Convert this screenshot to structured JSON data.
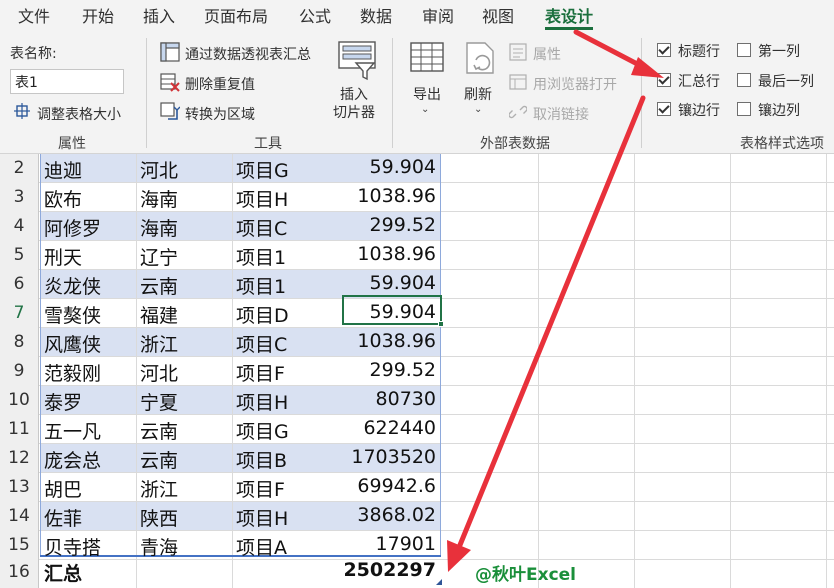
{
  "tabs": [
    "文件",
    "开始",
    "插入",
    "页面布局",
    "公式",
    "数据",
    "审阅",
    "视图",
    "表设计"
  ],
  "active_tab": "表设计",
  "ribbon": {
    "properties": {
      "name_label": "表名称:",
      "name_value": "表1",
      "resize_label": "调整表格大小",
      "group_label": "属性"
    },
    "tools": {
      "pivot_label": "通过数据透视表汇总",
      "remove_dup_label": "删除重复值",
      "convert_label": "转换为区域",
      "slicer_line1": "插入",
      "slicer_line2": "切片器",
      "group_label": "工具"
    },
    "external": {
      "export_label": "导出",
      "refresh_label": "刷新",
      "properties_label": "属性",
      "browser_label": "用浏览器打开",
      "unlink_label": "取消链接",
      "group_label": "外部表数据"
    },
    "style_options": {
      "header_row": {
        "label": "标题行",
        "checked": true
      },
      "total_row": {
        "label": "汇总行",
        "checked": true
      },
      "banded_rows": {
        "label": "镶边行",
        "checked": true
      },
      "first_col": {
        "label": "第一列",
        "checked": false
      },
      "last_col": {
        "label": "最后一列",
        "checked": false
      },
      "banded_cols": {
        "label": "镶边列",
        "checked": false
      },
      "group_label": "表格样式选项"
    }
  },
  "grid": {
    "rows": [
      {
        "num": "2",
        "name": "迪迦",
        "province": "河北",
        "project": "项目G",
        "value": "59.904"
      },
      {
        "num": "3",
        "name": "欧布",
        "province": "海南",
        "project": "项目H",
        "value": "1038.96"
      },
      {
        "num": "4",
        "name": "阿修罗",
        "province": "海南",
        "project": "项目C",
        "value": "299.52"
      },
      {
        "num": "5",
        "name": "刑天",
        "province": "辽宁",
        "project": "项目1",
        "value": "1038.96"
      },
      {
        "num": "6",
        "name": "炎龙侠",
        "province": "云南",
        "project": "项目1",
        "value": "59.904"
      },
      {
        "num": "7",
        "name": "雪獒侠",
        "province": "福建",
        "project": "项目D",
        "value": "59.904"
      },
      {
        "num": "8",
        "name": "风鹰侠",
        "province": "浙江",
        "project": "项目C",
        "value": "1038.96"
      },
      {
        "num": "9",
        "name": "范毅刚",
        "province": "河北",
        "project": "项目F",
        "value": "299.52"
      },
      {
        "num": "10",
        "name": "泰罗",
        "province": "宁夏",
        "project": "项目H",
        "value": "80730"
      },
      {
        "num": "11",
        "name": "五一凡",
        "province": "云南",
        "project": "项目G",
        "value": "622440"
      },
      {
        "num": "12",
        "name": "庞会总",
        "province": "云南",
        "project": "项目B",
        "value": "1703520"
      },
      {
        "num": "13",
        "name": "胡巴",
        "province": "浙江",
        "project": "项目F",
        "value": "69942.6"
      },
      {
        "num": "14",
        "name": "佐菲",
        "province": "陕西",
        "project": "项目H",
        "value": "3868.02"
      },
      {
        "num": "15",
        "name": "贝寺搭",
        "province": "青海",
        "project": "项目A",
        "value": "17901"
      }
    ],
    "total_row": {
      "num": "16",
      "label": "汇总",
      "value": "2502297"
    },
    "selected_row": "7"
  },
  "watermark": "@秋叶Excel",
  "colors": {
    "accent": "#1b6f3d",
    "band": "#d9e1f2",
    "arrow": "#e8313b"
  }
}
